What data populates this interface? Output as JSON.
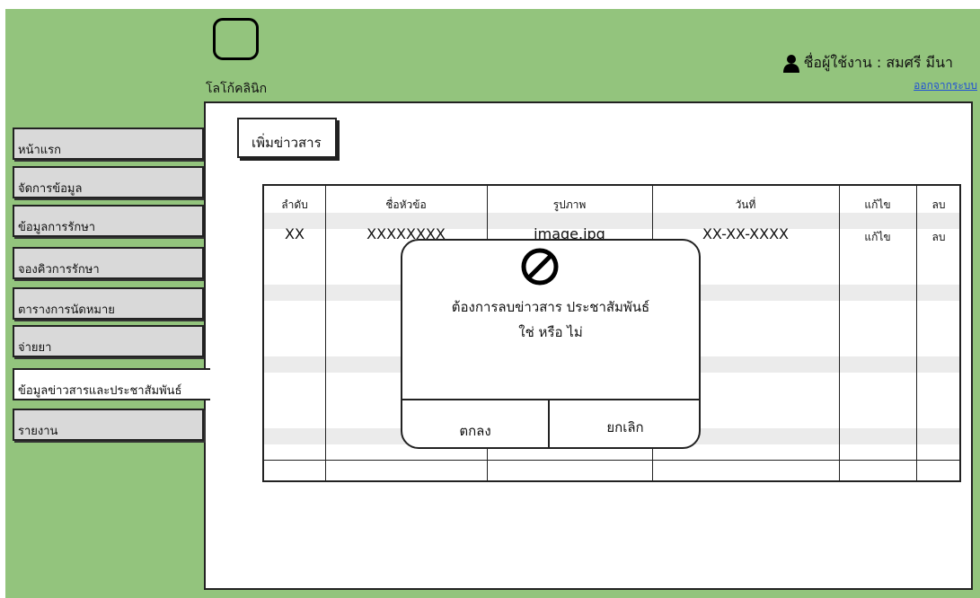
{
  "header": {
    "logo_text": "โลโก้คลินิก",
    "user_label": "ชื่อผู้ใช้งาน : สมศรี  มีนา",
    "logout_label": "ออกจากระบบ"
  },
  "sidebar": {
    "items": [
      {
        "label": "หน้าแรก",
        "active": false
      },
      {
        "label": "จัดการข้อมูล",
        "active": false
      },
      {
        "label": "ข้อมูลการรักษา",
        "active": false
      },
      {
        "label": "จองคิวการรักษา",
        "active": false
      },
      {
        "label": "ตารางการนัดหมาย",
        "active": false
      },
      {
        "label": "จ่ายยา",
        "active": false
      },
      {
        "label": "ข้อมูลข่าวสารและประชาสัมพันธ์",
        "active": true
      },
      {
        "label": "รายงาน",
        "active": false
      }
    ]
  },
  "main": {
    "add_button": "เพิ่มข่าวสาร",
    "table": {
      "headers": [
        "ลำดับ",
        "ชื่อหัวข้อ",
        "รูปภาพ",
        "วันที่",
        "แก้ไข",
        "ลบ"
      ],
      "rows": [
        [
          "XX",
          "XXXXXXXX",
          "image.jpg",
          "XX-XX-XXXX",
          "แก้ไข",
          "ลบ"
        ]
      ]
    }
  },
  "modal": {
    "icon": "ban-icon",
    "message_line1": "ต้องการลบข่าวสาร ประชาสัมพันธ์",
    "message_line2": "ใช่ หรือ ไม่",
    "confirm_label": "ตกลง",
    "cancel_label": "ยกเลิก"
  },
  "colors": {
    "background_green": "#93c47d",
    "sidebar_gray": "#d9d9d9",
    "link_blue": "#1f4fd6"
  }
}
